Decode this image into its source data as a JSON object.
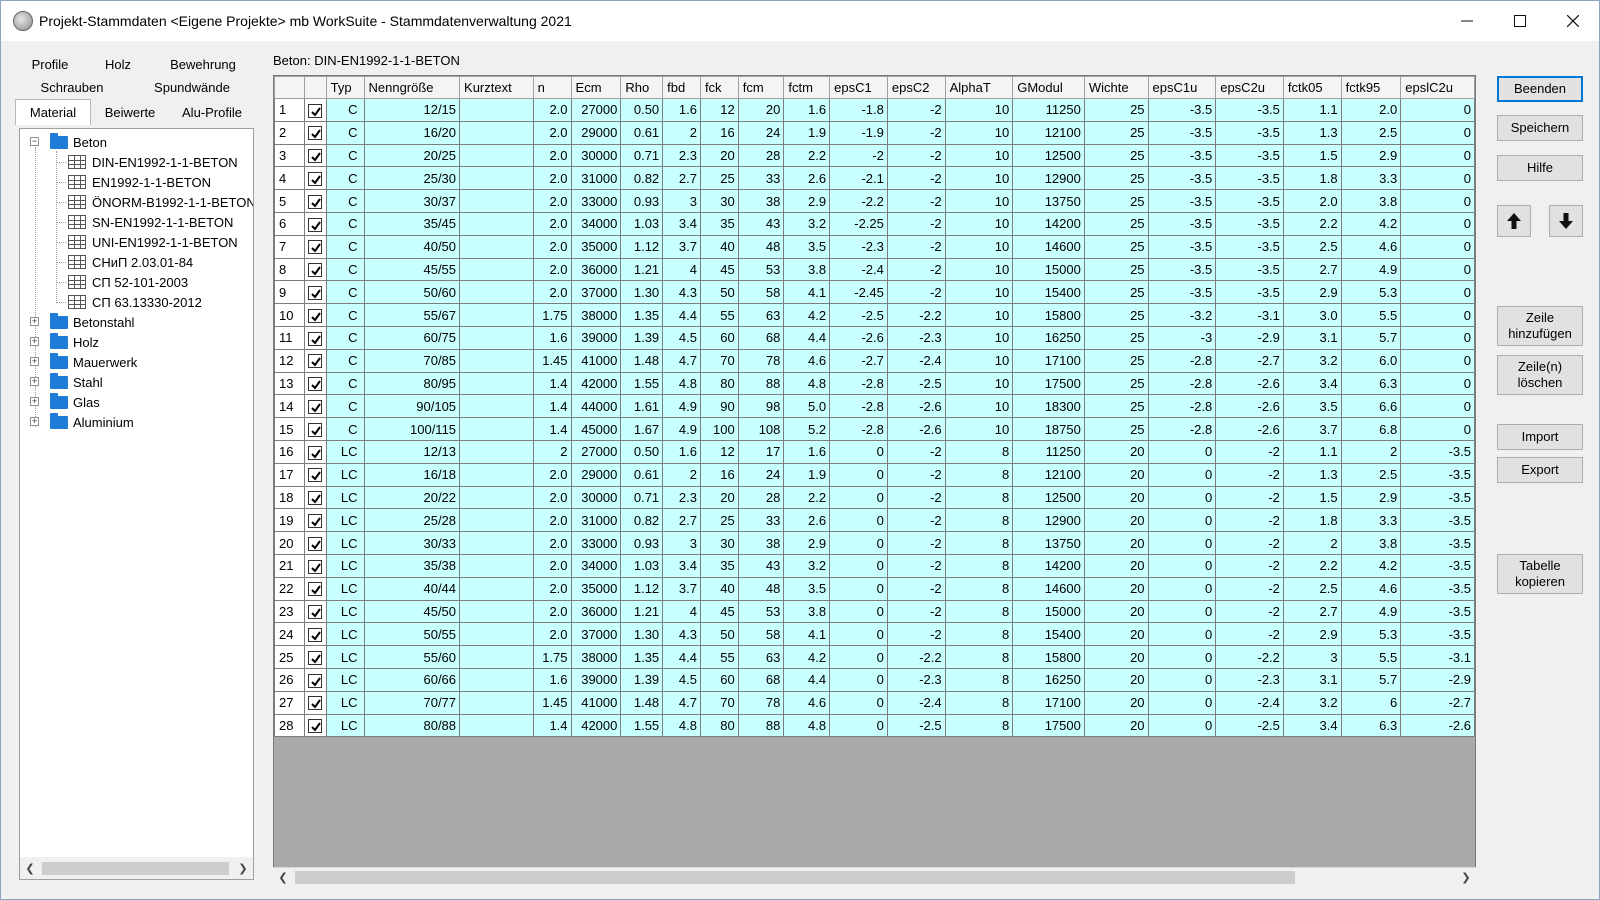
{
  "window": {
    "title": "Projekt-Stammdaten <Eigene Projekte> mb WorkSuite - Stammdatenverwaltung 2021"
  },
  "tabs": {
    "row1": [
      "Profile",
      "Holz",
      "Bewehrung"
    ],
    "row2": [
      "Schrauben",
      "Spundwände"
    ],
    "row3": [
      "Material",
      "Beiwerte",
      "Alu-Profile"
    ],
    "active": "Material"
  },
  "tree": {
    "beton": "Beton",
    "beton_children": [
      "DIN-EN1992-1-1-BETON",
      "EN1992-1-1-BETON",
      "ÖNORM-B1992-1-1-BETON",
      "SN-EN1992-1-1-BETON",
      "UNI-EN1992-1-1-BETON",
      "СНиП 2.03.01-84",
      "СП 52-101-2003",
      "СП 63.13330-2012"
    ],
    "others": [
      "Betonstahl",
      "Holz",
      "Mauerwerk",
      "Stahl",
      "Glas",
      "Aluminium"
    ]
  },
  "grid": {
    "caption": "Beton: DIN-EN1992-1-1-BETON",
    "columns": [
      "",
      "",
      "Typ",
      "Nenngröße",
      "Kurztext",
      "n",
      "Ecm",
      "Rho",
      "fbd",
      "fck",
      "fcm",
      "fctm",
      "epsC1",
      "epsC2",
      "AlphaT",
      "GModul",
      "Wichte",
      "epsC1u",
      "epsC2u",
      "fctk05",
      "fctk95",
      "epslC2u"
    ],
    "rows": [
      [
        "1",
        "C",
        "12/15",
        "",
        "2.0",
        "27000",
        "0.50",
        "1.6",
        "12",
        "20",
        "1.6",
        "-1.8",
        "-2",
        "10",
        "11250",
        "25",
        "-3.5",
        "-3.5",
        "1.1",
        "2.0",
        "0"
      ],
      [
        "2",
        "C",
        "16/20",
        "",
        "2.0",
        "29000",
        "0.61",
        "2",
        "16",
        "24",
        "1.9",
        "-1.9",
        "-2",
        "10",
        "12100",
        "25",
        "-3.5",
        "-3.5",
        "1.3",
        "2.5",
        "0"
      ],
      [
        "3",
        "C",
        "20/25",
        "",
        "2.0",
        "30000",
        "0.71",
        "2.3",
        "20",
        "28",
        "2.2",
        "-2",
        "-2",
        "10",
        "12500",
        "25",
        "-3.5",
        "-3.5",
        "1.5",
        "2.9",
        "0"
      ],
      [
        "4",
        "C",
        "25/30",
        "",
        "2.0",
        "31000",
        "0.82",
        "2.7",
        "25",
        "33",
        "2.6",
        "-2.1",
        "-2",
        "10",
        "12900",
        "25",
        "-3.5",
        "-3.5",
        "1.8",
        "3.3",
        "0"
      ],
      [
        "5",
        "C",
        "30/37",
        "",
        "2.0",
        "33000",
        "0.93",
        "3",
        "30",
        "38",
        "2.9",
        "-2.2",
        "-2",
        "10",
        "13750",
        "25",
        "-3.5",
        "-3.5",
        "2.0",
        "3.8",
        "0"
      ],
      [
        "6",
        "C",
        "35/45",
        "",
        "2.0",
        "34000",
        "1.03",
        "3.4",
        "35",
        "43",
        "3.2",
        "-2.25",
        "-2",
        "10",
        "14200",
        "25",
        "-3.5",
        "-3.5",
        "2.2",
        "4.2",
        "0"
      ],
      [
        "7",
        "C",
        "40/50",
        "",
        "2.0",
        "35000",
        "1.12",
        "3.7",
        "40",
        "48",
        "3.5",
        "-2.3",
        "-2",
        "10",
        "14600",
        "25",
        "-3.5",
        "-3.5",
        "2.5",
        "4.6",
        "0"
      ],
      [
        "8",
        "C",
        "45/55",
        "",
        "2.0",
        "36000",
        "1.21",
        "4",
        "45",
        "53",
        "3.8",
        "-2.4",
        "-2",
        "10",
        "15000",
        "25",
        "-3.5",
        "-3.5",
        "2.7",
        "4.9",
        "0"
      ],
      [
        "9",
        "C",
        "50/60",
        "",
        "2.0",
        "37000",
        "1.30",
        "4.3",
        "50",
        "58",
        "4.1",
        "-2.45",
        "-2",
        "10",
        "15400",
        "25",
        "-3.5",
        "-3.5",
        "2.9",
        "5.3",
        "0"
      ],
      [
        "10",
        "C",
        "55/67",
        "",
        "1.75",
        "38000",
        "1.35",
        "4.4",
        "55",
        "63",
        "4.2",
        "-2.5",
        "-2.2",
        "10",
        "15800",
        "25",
        "-3.2",
        "-3.1",
        "3.0",
        "5.5",
        "0"
      ],
      [
        "11",
        "C",
        "60/75",
        "",
        "1.6",
        "39000",
        "1.39",
        "4.5",
        "60",
        "68",
        "4.4",
        "-2.6",
        "-2.3",
        "10",
        "16250",
        "25",
        "-3",
        "-2.9",
        "3.1",
        "5.7",
        "0"
      ],
      [
        "12",
        "C",
        "70/85",
        "",
        "1.45",
        "41000",
        "1.48",
        "4.7",
        "70",
        "78",
        "4.6",
        "-2.7",
        "-2.4",
        "10",
        "17100",
        "25",
        "-2.8",
        "-2.7",
        "3.2",
        "6.0",
        "0"
      ],
      [
        "13",
        "C",
        "80/95",
        "",
        "1.4",
        "42000",
        "1.55",
        "4.8",
        "80",
        "88",
        "4.8",
        "-2.8",
        "-2.5",
        "10",
        "17500",
        "25",
        "-2.8",
        "-2.6",
        "3.4",
        "6.3",
        "0"
      ],
      [
        "14",
        "C",
        "90/105",
        "",
        "1.4",
        "44000",
        "1.61",
        "4.9",
        "90",
        "98",
        "5.0",
        "-2.8",
        "-2.6",
        "10",
        "18300",
        "25",
        "-2.8",
        "-2.6",
        "3.5",
        "6.6",
        "0"
      ],
      [
        "15",
        "C",
        "100/115",
        "",
        "1.4",
        "45000",
        "1.67",
        "4.9",
        "100",
        "108",
        "5.2",
        "-2.8",
        "-2.6",
        "10",
        "18750",
        "25",
        "-2.8",
        "-2.6",
        "3.7",
        "6.8",
        "0"
      ],
      [
        "16",
        "LC",
        "12/13",
        "",
        "2",
        "27000",
        "0.50",
        "1.6",
        "12",
        "17",
        "1.6",
        "0",
        "-2",
        "8",
        "11250",
        "20",
        "0",
        "-2",
        "1.1",
        "2",
        "-3.5"
      ],
      [
        "17",
        "LC",
        "16/18",
        "",
        "2.0",
        "29000",
        "0.61",
        "2",
        "16",
        "24",
        "1.9",
        "0",
        "-2",
        "8",
        "12100",
        "20",
        "0",
        "-2",
        "1.3",
        "2.5",
        "-3.5"
      ],
      [
        "18",
        "LC",
        "20/22",
        "",
        "2.0",
        "30000",
        "0.71",
        "2.3",
        "20",
        "28",
        "2.2",
        "0",
        "-2",
        "8",
        "12500",
        "20",
        "0",
        "-2",
        "1.5",
        "2.9",
        "-3.5"
      ],
      [
        "19",
        "LC",
        "25/28",
        "",
        "2.0",
        "31000",
        "0.82",
        "2.7",
        "25",
        "33",
        "2.6",
        "0",
        "-2",
        "8",
        "12900",
        "20",
        "0",
        "-2",
        "1.8",
        "3.3",
        "-3.5"
      ],
      [
        "20",
        "LC",
        "30/33",
        "",
        "2.0",
        "33000",
        "0.93",
        "3",
        "30",
        "38",
        "2.9",
        "0",
        "-2",
        "8",
        "13750",
        "20",
        "0",
        "-2",
        "2",
        "3.8",
        "-3.5"
      ],
      [
        "21",
        "LC",
        "35/38",
        "",
        "2.0",
        "34000",
        "1.03",
        "3.4",
        "35",
        "43",
        "3.2",
        "0",
        "-2",
        "8",
        "14200",
        "20",
        "0",
        "-2",
        "2.2",
        "4.2",
        "-3.5"
      ],
      [
        "22",
        "LC",
        "40/44",
        "",
        "2.0",
        "35000",
        "1.12",
        "3.7",
        "40",
        "48",
        "3.5",
        "0",
        "-2",
        "8",
        "14600",
        "20",
        "0",
        "-2",
        "2.5",
        "4.6",
        "-3.5"
      ],
      [
        "23",
        "LC",
        "45/50",
        "",
        "2.0",
        "36000",
        "1.21",
        "4",
        "45",
        "53",
        "3.8",
        "0",
        "-2",
        "8",
        "15000",
        "20",
        "0",
        "-2",
        "2.7",
        "4.9",
        "-3.5"
      ],
      [
        "24",
        "LC",
        "50/55",
        "",
        "2.0",
        "37000",
        "1.30",
        "4.3",
        "50",
        "58",
        "4.1",
        "0",
        "-2",
        "8",
        "15400",
        "20",
        "0",
        "-2",
        "2.9",
        "5.3",
        "-3.5"
      ],
      [
        "25",
        "LC",
        "55/60",
        "",
        "1.75",
        "38000",
        "1.35",
        "4.4",
        "55",
        "63",
        "4.2",
        "0",
        "-2.2",
        "8",
        "15800",
        "20",
        "0",
        "-2.2",
        "3",
        "5.5",
        "-3.1"
      ],
      [
        "26",
        "LC",
        "60/66",
        "",
        "1.6",
        "39000",
        "1.39",
        "4.5",
        "60",
        "68",
        "4.4",
        "0",
        "-2.3",
        "8",
        "16250",
        "20",
        "0",
        "-2.3",
        "3.1",
        "5.7",
        "-2.9"
      ],
      [
        "27",
        "LC",
        "70/77",
        "",
        "1.45",
        "41000",
        "1.48",
        "4.7",
        "70",
        "78",
        "4.6",
        "0",
        "-2.4",
        "8",
        "17100",
        "20",
        "0",
        "-2.4",
        "3.2",
        "6",
        "-2.7"
      ],
      [
        "28",
        "LC",
        "80/88",
        "",
        "1.4",
        "42000",
        "1.55",
        "4.8",
        "80",
        "88",
        "4.8",
        "0",
        "-2.5",
        "8",
        "17500",
        "20",
        "0",
        "-2.5",
        "3.4",
        "6.3",
        "-2.6"
      ]
    ]
  },
  "buttons": {
    "beenden": "Beenden",
    "speichern": "Speichern",
    "hilfe": "Hilfe",
    "zeile_hinzufuegen": [
      "Zeile",
      "hinzufügen"
    ],
    "zeilen_loeschen": [
      "Zeile(n)",
      "löschen"
    ],
    "import": "Import",
    "export": "Export",
    "tabelle_kopieren": [
      "Tabelle",
      "kopieren"
    ]
  },
  "icons": {
    "up": "arrow-up-icon",
    "down": "arrow-down-icon"
  },
  "colors": {
    "cell_bg": "#c8ffff",
    "folder": "#1e7bd8",
    "default_button_border": "#0078d7"
  }
}
